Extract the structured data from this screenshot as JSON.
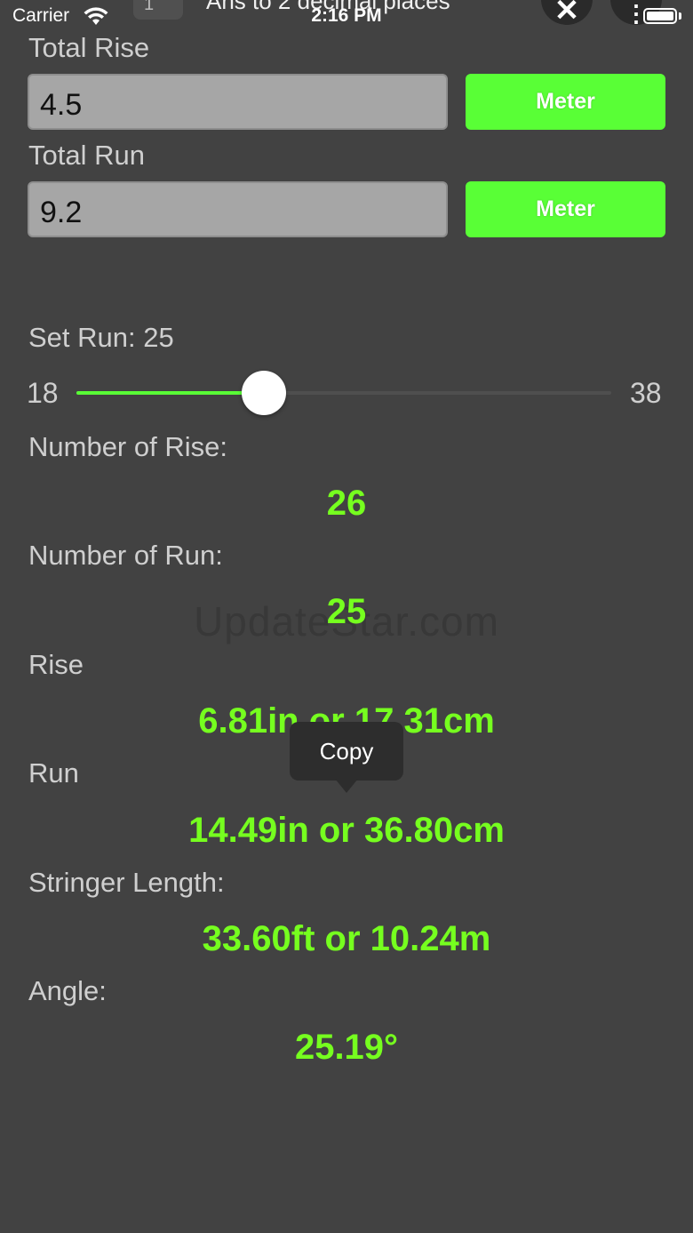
{
  "status_bar": {
    "carrier": "Carrier",
    "time": "2:16 PM"
  },
  "header": {
    "title_partial": "Ans to 2 decimal places",
    "left_control_partial": "1",
    "close_icon": "close-icon",
    "more_icon": "more-icon"
  },
  "form": {
    "total_rise_label": "Total Rise",
    "total_rise_value": "4.5",
    "total_rise_unit": "Meter",
    "total_run_label": "Total Run",
    "total_run_value": "9.2",
    "total_run_unit": "Meter"
  },
  "slider": {
    "label": "Set Run: 25",
    "min_label": "18",
    "max_label": "38",
    "min": 18,
    "max": 38,
    "value": 25
  },
  "results": {
    "number_of_rise_label": "Number of Rise:",
    "number_of_rise_value": "26",
    "number_of_run_label": "Number of Run:",
    "number_of_run_value": "25",
    "rise_label": "Rise",
    "rise_value": "6.81in or 17.31cm",
    "run_label": "Run",
    "run_value": "14.49in or 36.80cm",
    "stringer_label": "Stringer Length:",
    "stringer_value": "33.60ft or 10.24m",
    "angle_label": "Angle:",
    "angle_value": "25.19°"
  },
  "tooltip": {
    "copy_label": "Copy"
  },
  "watermark": "UpdateStar.com",
  "colors": {
    "accent": "#59ff36",
    "result_text": "#76ff1f",
    "background": "#424242"
  }
}
